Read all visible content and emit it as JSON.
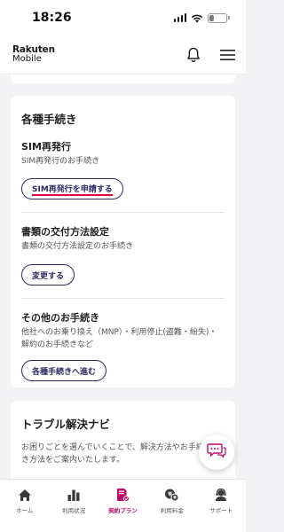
{
  "status_bar": {
    "time": "18:26",
    "battery_level": "23",
    "battery_fraction": 0.23
  },
  "header": {
    "logo_line1": "Rakuten",
    "logo_line2": "Mobile",
    "icons": [
      "bell-icon",
      "menu-icon"
    ]
  },
  "procedures": {
    "title": "各種手続き",
    "items": [
      {
        "title": "SIM再発行",
        "description": "SIM再発行のお手続き",
        "button": "SIM再発行を申請する"
      },
      {
        "title": "書類の交付方法設定",
        "description": "書類の交付方法設定のお手続き",
        "button": "変更する"
      },
      {
        "title": "その他のお手続き",
        "description": "他社へのお乗り換え（MNP）・利用停止(盗難・紛失)・解約のお手続きなど",
        "button": "各種手続きへ進む"
      }
    ]
  },
  "trouble": {
    "title": "トラブル解決ナビ",
    "description": "お困りごとを選んでいくことで、解決方法やお手続き方法をご案内いたします。"
  },
  "chat_icon": "chat-icon",
  "nav": {
    "items": [
      {
        "label": "ホーム",
        "icon": "home-icon"
      },
      {
        "label": "利用状況",
        "icon": "usage-chart-icon"
      },
      {
        "label": "契約プラン",
        "icon": "contract-plan-icon"
      },
      {
        "label": "利用料金",
        "icon": "billing-icon"
      },
      {
        "label": "サポート",
        "icon": "support-icon"
      }
    ],
    "active_color": "#bf0a6c"
  },
  "colors": {
    "accent_red": "#e5003f",
    "button_navy": "#2e2b63",
    "background": "#f3f3f6"
  }
}
